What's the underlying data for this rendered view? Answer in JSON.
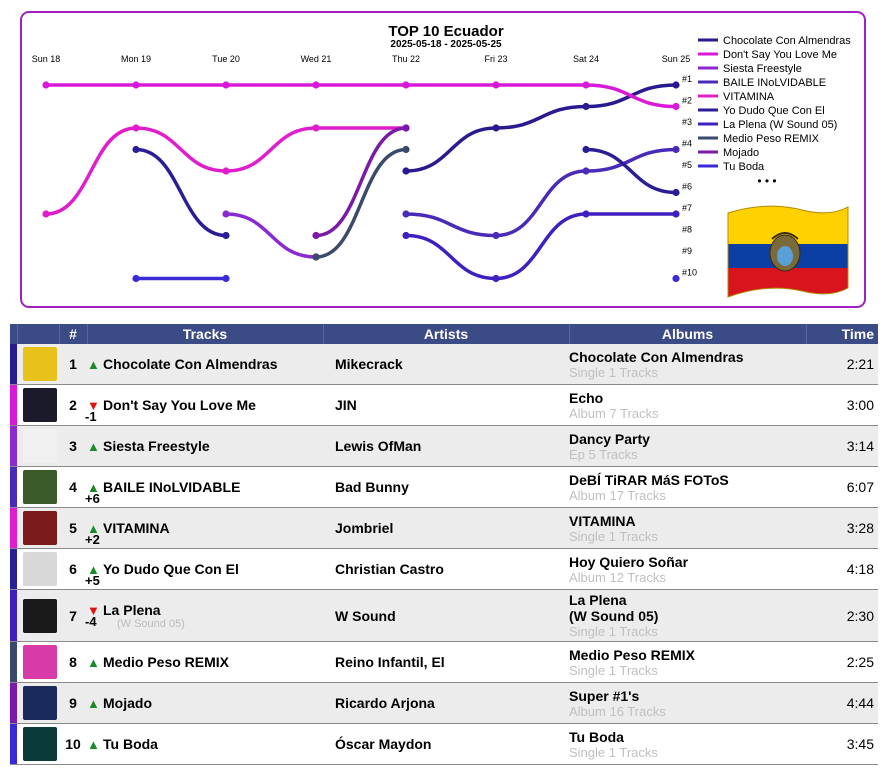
{
  "chart_data": {
    "type": "line",
    "title": "TOP 10 Ecuador",
    "subtitle": "2025-05-18 - 2025-05-25",
    "x": [
      "Sun 18",
      "Mon 19",
      "Tue 20",
      "Wed 21",
      "Thu 22",
      "Fri 23",
      "Sat 24",
      "Sun 25"
    ],
    "rank_labels": [
      "#1",
      "#2",
      "#3",
      "#4",
      "#5",
      "#6",
      "#7",
      "#8",
      "#9",
      "#10"
    ],
    "ylim": [
      1,
      10
    ],
    "y_inverted": true,
    "grid": false,
    "legend_position": "right",
    "legend_more": "• • •",
    "series": [
      {
        "name": "Chocolate Con Almendras",
        "color": "#2a1a8f",
        "values": [
          null,
          null,
          null,
          null,
          5,
          3,
          2,
          1
        ]
      },
      {
        "name": "Don't Say You Love Me",
        "color": "#d81ad8",
        "values": [
          1,
          1,
          1,
          1,
          1,
          1,
          1,
          2
        ]
      },
      {
        "name": "Siesta Freestyle",
        "color": "#8b2ad1",
        "values": [
          null,
          null,
          7,
          9,
          null,
          null,
          null,
          null
        ]
      },
      {
        "name": "BAILE INoLVIDABLE",
        "color": "#4a2ab8",
        "values": [
          null,
          null,
          null,
          null,
          7,
          8,
          5,
          4
        ]
      },
      {
        "name": "VITAMINA",
        "color": "#e01ccc",
        "values": [
          7,
          3,
          5,
          3,
          3,
          null,
          null,
          null
        ]
      },
      {
        "name": "Yo Dudo Que Con El",
        "color": "#2a1e96",
        "values": [
          null,
          4,
          8,
          null,
          null,
          null,
          4,
          6
        ]
      },
      {
        "name": "La Plena (W Sound 05)",
        "color": "#3e1fc0",
        "values": [
          null,
          null,
          null,
          null,
          8,
          10,
          7,
          7
        ]
      },
      {
        "name": "Medio Peso REMIX",
        "color": "#3a4a6a",
        "values": [
          null,
          null,
          null,
          9,
          4,
          null,
          null,
          null
        ]
      },
      {
        "name": "Mojado",
        "color": "#7a1aa8",
        "values": [
          null,
          null,
          null,
          8,
          3,
          null,
          null,
          null
        ]
      },
      {
        "name": "Tu Boda",
        "color": "#3a2ad8",
        "values": [
          null,
          10,
          10,
          null,
          null,
          null,
          null,
          10
        ]
      }
    ]
  },
  "flag": {
    "name": "ecuador-flag-image",
    "colors": [
      "#ffd100",
      "#0b3fa3",
      "#d8141c"
    ]
  },
  "table": {
    "headers": {
      "rank": "#",
      "tracks": "Tracks",
      "artists": "Artists",
      "albums": "Albums",
      "time": "Time"
    },
    "rows": [
      {
        "rank": "1",
        "title": "Chocolate Con Almendras",
        "subtitle": "",
        "trend": "up",
        "delta": "",
        "artist": "Mikecrack",
        "album": "Chocolate Con Almendras",
        "album_meta": "Single 1 Tracks",
        "time": "2:21",
        "stripe": "#2a1a8f",
        "cover": "#e8c21a",
        "cover_icon": "cartoon-cover-icon"
      },
      {
        "rank": "2",
        "title": "Don't Say You Love Me",
        "subtitle": "",
        "trend": "down",
        "delta": "-1",
        "artist": "JIN",
        "album": "Echo",
        "album_meta": "Album 7 Tracks",
        "time": "3:00",
        "stripe": "#d81ad8",
        "cover": "#1a1a2a",
        "cover_icon": "echo-cover-icon"
      },
      {
        "rank": "3",
        "title": "Siesta Freestyle",
        "subtitle": "",
        "trend": "up",
        "delta": "",
        "artist": "Lewis OfMan",
        "album": "Dancy Party",
        "album_meta": "Ep 5 Tracks",
        "time": "3:14",
        "stripe": "#8b2ad1",
        "cover": "#f0f0f0",
        "cover_icon": "doodle-cover-icon"
      },
      {
        "rank": "4",
        "title": "BAILE INoLVIDABLE",
        "subtitle": "",
        "trend": "up",
        "delta": "+6",
        "artist": "Bad Bunny",
        "album": "DeBÍ TiRAR MáS FOToS",
        "album_meta": "Album 17 Tracks",
        "time": "6:07",
        "stripe": "#4a2ab8",
        "cover": "#3a5a2a",
        "cover_icon": "chairs-cover-icon"
      },
      {
        "rank": "5",
        "title": "VITAMINA",
        "subtitle": "",
        "trend": "up",
        "delta": "+2",
        "artist": "Jombriel",
        "album": "VITAMINA",
        "album_meta": "Single 1 Tracks",
        "time": "3:28",
        "stripe": "#e01ccc",
        "cover": "#7a1a1a",
        "cover_icon": "group-cover-icon"
      },
      {
        "rank": "6",
        "title": "Yo Dudo Que Con El",
        "subtitle": "",
        "trend": "up",
        "delta": "+5",
        "artist": "Christian Castro",
        "album": "Hoy Quiero Soñar",
        "album_meta": "Album 12 Tracks",
        "time": "4:18",
        "stripe": "#2a1e96",
        "cover": "#d8d8d8",
        "cover_icon": "portrait-cover-icon"
      },
      {
        "rank": "7",
        "title": "La Plena",
        "subtitle": "(W Sound 05)",
        "trend": "down",
        "delta": "-4",
        "artist": "W Sound",
        "album": "La Plena\n(W Sound 05)",
        "album_meta": "Single 1 Tracks",
        "time": "2:30",
        "stripe": "#3e1fc0",
        "cover": "#1a1a1a",
        "cover_icon": "wsound-cover-icon"
      },
      {
        "rank": "8",
        "title": "Medio Peso REMIX",
        "subtitle": "",
        "trend": "up",
        "delta": "",
        "artist": "Reino Infantil, El",
        "album": "Medio Peso REMIX",
        "album_meta": "Single 1 Tracks",
        "time": "2:25",
        "stripe": "#3a4a6a",
        "cover": "#d83aa8",
        "cover_icon": "kids-cover-icon"
      },
      {
        "rank": "9",
        "title": "Mojado",
        "subtitle": "",
        "trend": "up",
        "delta": "",
        "artist": "Ricardo Arjona",
        "album": "Super #1's",
        "album_meta": "Album 16 Tracks",
        "time": "4:44",
        "stripe": "#7a1aa8",
        "cover": "#1a2a5a",
        "cover_icon": "stage-cover-icon"
      },
      {
        "rank": "10",
        "title": "Tu Boda",
        "subtitle": "",
        "trend": "up",
        "delta": "",
        "artist": "Óscar Maydon",
        "album": "Tu Boda",
        "album_meta": "Single 1 Tracks",
        "time": "3:45",
        "stripe": "#3a2ad8",
        "cover": "#0a3a3a",
        "cover_icon": "arch-cover-icon"
      }
    ]
  }
}
